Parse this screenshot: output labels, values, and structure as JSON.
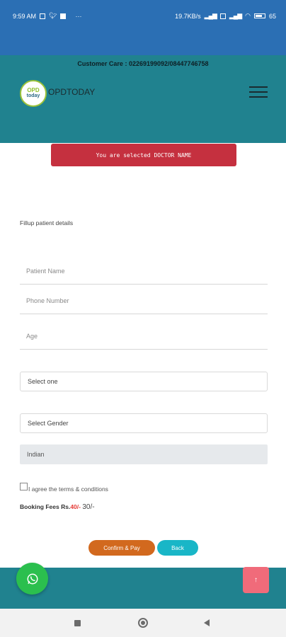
{
  "status_bar": {
    "time": "9:59 AM",
    "speed": "19.7KB/s",
    "battery": "65"
  },
  "header": {
    "customer_care": "Customer Care : 02269199092/08447746758",
    "logo_line1": "OPD",
    "logo_line2": "today",
    "brand": "OPDTODAY"
  },
  "alert": {
    "text": "You are selected DOCTOR NAME"
  },
  "form": {
    "section_title": "Fillup patient details",
    "patient_name_placeholder": "Patient Name",
    "phone_placeholder": "Phone Number",
    "age_placeholder": "Age",
    "select_one": "Select one",
    "select_gender": "Select Gender",
    "nationality": "Indian",
    "terms_label": "I agree the terms & conditions",
    "fees_label": "Booking Fees Rs.",
    "fees_old": "40/-",
    "fees_new": "30/-",
    "confirm_label": "Confirm & Pay",
    "back_label": "Back"
  },
  "colors": {
    "status_bar": "#2b6fb4",
    "header": "#20828f",
    "alert": "#c5303f",
    "confirm": "#d2691e",
    "back": "#19b6c7",
    "whatsapp": "#2bbf4e",
    "scroll_top": "#f06b7a"
  },
  "icons": [
    "whatsapp-icon",
    "arrow-up-icon",
    "menu-icon",
    "wifi-icon",
    "battery-icon"
  ]
}
